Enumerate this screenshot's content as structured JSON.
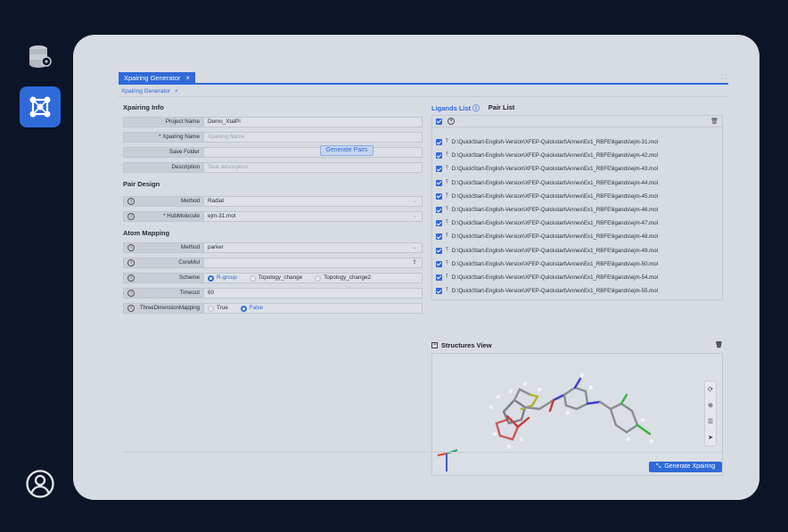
{
  "tabs": {
    "main": "Xpairing Generator",
    "sub": "Xpairing Generator"
  },
  "xpairing_info": {
    "title": "Xpairing Info",
    "project_name": {
      "label": "Project Name",
      "value": "Demo_XtalPi"
    },
    "xpairing_name": {
      "label": "* Xpairing Name",
      "placeholder": "Xpairing Name"
    },
    "save_folder": {
      "label": "Save Folder",
      "value": ""
    },
    "description": {
      "label": "Description",
      "placeholder": "Task description"
    }
  },
  "pair_design": {
    "title": "Pair Design",
    "generate_pairs": "Generate Pairs",
    "method": {
      "label": "Method",
      "value": "Radial"
    },
    "hub_molecule": {
      "label": "* HubMolecule",
      "value": "ejm-31.mol"
    }
  },
  "atom_mapping": {
    "title": "Atom Mapping",
    "method": {
      "label": "Method",
      "value": "parker"
    },
    "core_mol": {
      "label": "CoreMol",
      "value": ""
    },
    "scheme": {
      "label": "Scheme",
      "options": [
        "R-group",
        "Topology_change",
        "Topology_change2"
      ],
      "selected": 0
    },
    "timeout": {
      "label": "Timeout",
      "value": "60"
    },
    "three_dim": {
      "label": "ThreeDimensionMapping",
      "options": [
        "True",
        "False"
      ],
      "selected": 1
    }
  },
  "right": {
    "tab_ligands": "Ligands List",
    "tab_pairs": "Pair List",
    "ligands": [
      "D:\\QuickStart-English-Version\\XFEP-Quickstart\\Annex\\Ex1_RBFE\\ligands\\ejm-31.mol",
      "D:\\QuickStart-English-Version\\XFEP-Quickstart\\Annex\\Ex1_RBFE\\ligands\\ejm-42.mol",
      "D:\\QuickStart-English-Version\\XFEP-Quickstart\\Annex\\Ex1_RBFE\\ligands\\ejm-43.mol",
      "D:\\QuickStart-English-Version\\XFEP-Quickstart\\Annex\\Ex1_RBFE\\ligands\\ejm-44.mol",
      "D:\\QuickStart-English-Version\\XFEP-Quickstart\\Annex\\Ex1_RBFE\\ligands\\ejm-45.mol",
      "D:\\QuickStart-English-Version\\XFEP-Quickstart\\Annex\\Ex1_RBFE\\ligands\\ejm-46.mol",
      "D:\\QuickStart-English-Version\\XFEP-Quickstart\\Annex\\Ex1_RBFE\\ligands\\ejm-47.mol",
      "D:\\QuickStart-English-Version\\XFEP-Quickstart\\Annex\\Ex1_RBFE\\ligands\\ejm-48.mol",
      "D:\\QuickStart-English-Version\\XFEP-Quickstart\\Annex\\Ex1_RBFE\\ligands\\ejm-49.mol",
      "D:\\QuickStart-English-Version\\XFEP-Quickstart\\Annex\\Ex1_RBFE\\ligands\\ejm-50.mol",
      "D:\\QuickStart-English-Version\\XFEP-Quickstart\\Annex\\Ex1_RBFE\\ligands\\ejm-54.mol",
      "D:\\QuickStart-English-Version\\XFEP-Quickstart\\Annex\\Ex1_RBFE\\ligands\\ejm-55.mol"
    ],
    "structures_view": "Structures View"
  },
  "generate_xpairing": "Generate Xpairing",
  "colors": {
    "accent": "#2f6ad9",
    "background": "#0b1527",
    "panel": "#d7dbe2"
  }
}
